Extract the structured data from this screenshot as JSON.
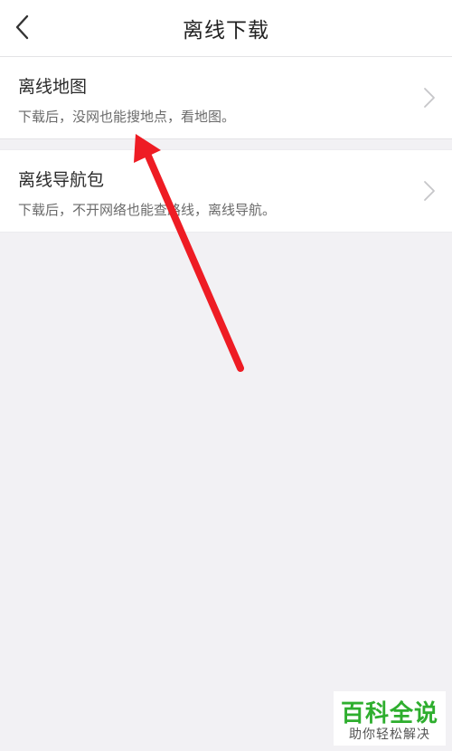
{
  "header": {
    "title": "离线下载",
    "back_icon": "back-chevron-icon"
  },
  "items": [
    {
      "title": "离线地图",
      "subtitle": "下载后，没网也能搜地点，看地图。",
      "icon": "chevron-right-icon"
    },
    {
      "title": "离线导航包",
      "subtitle": "下载后，不开网络也能查路线，离线导航。",
      "icon": "chevron-right-icon"
    }
  ],
  "annotation": {
    "arrow_color": "#ee1c24"
  },
  "watermark": {
    "brand": "百科全说",
    "slogan": "助你轻松解决",
    "brand_color": "#2eae2e"
  }
}
